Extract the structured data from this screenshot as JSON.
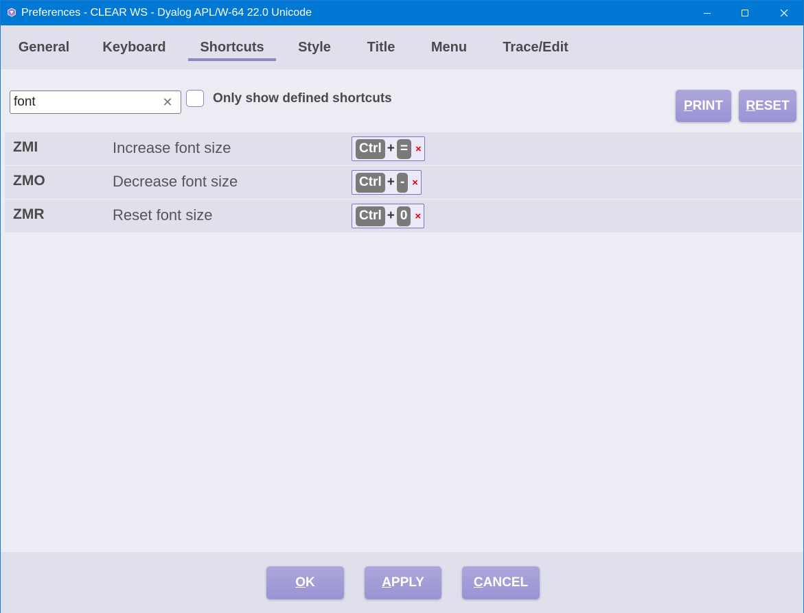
{
  "window": {
    "title": "Preferences - CLEAR WS - Dyalog APL/W-64 22.0 Unicode"
  },
  "tabs": [
    {
      "label": "General"
    },
    {
      "label": "Keyboard"
    },
    {
      "label": "Shortcuts"
    },
    {
      "label": "Style"
    },
    {
      "label": "Title"
    },
    {
      "label": "Menu"
    },
    {
      "label": "Trace/Edit"
    }
  ],
  "active_tab": "Shortcuts",
  "search": {
    "value": "font",
    "clear_glyph": "✕"
  },
  "filter": {
    "label": "Only show defined shortcuts",
    "checked": false
  },
  "actions": {
    "print_first": "P",
    "print_rest": "RINT",
    "reset_first": "R",
    "reset_rest": "ESET"
  },
  "shortcuts": [
    {
      "code": "ZMI",
      "description": "Increase font size",
      "keys": [
        "Ctrl",
        "="
      ]
    },
    {
      "code": "ZMO",
      "description": "Decrease font size",
      "keys": [
        "Ctrl",
        "-"
      ]
    },
    {
      "code": "ZMR",
      "description": "Reset font size",
      "keys": [
        "Ctrl",
        "0"
      ]
    }
  ],
  "key_plus": "+",
  "key_delete_glyph": "×",
  "footer": {
    "ok_first": "O",
    "ok_rest": "K",
    "apply_first": "A",
    "apply_rest": "PPLY",
    "cancel_first": "C",
    "cancel_rest": "ANCEL"
  },
  "colors": {
    "titlebar": "#0078d4",
    "accent": "#9a93d3",
    "panel": "#dfe0ec",
    "keycap": "#7a7a7a",
    "delete": "#e00000"
  }
}
